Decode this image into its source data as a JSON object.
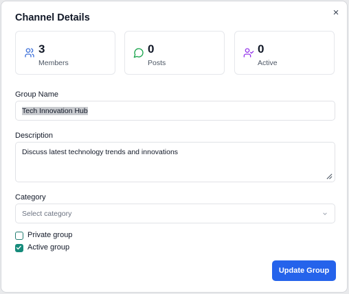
{
  "dialog": {
    "title": "Channel Details",
    "close_symbol": "×"
  },
  "stats": [
    {
      "value": "3",
      "label": "Members",
      "icon": "users-icon",
      "color": "#3b6fd9"
    },
    {
      "value": "0",
      "label": "Posts",
      "icon": "message-circle-icon",
      "color": "#16a34a"
    },
    {
      "value": "0",
      "label": "Active",
      "icon": "user-check-icon",
      "color": "#9333ea"
    }
  ],
  "form": {
    "group_name_label": "Group Name",
    "group_name_value": "Tech Innovation Hub",
    "description_label": "Description",
    "description_value": "Discuss latest technology trends and innovations",
    "category_label": "Category",
    "category_placeholder": "Select category",
    "private_label": "Private group",
    "private_checked": false,
    "active_label": "Active group",
    "active_checked": true,
    "submit_label": "Update Group"
  },
  "colors": {
    "accent": "#2563eb",
    "checkbox": "#168b7b"
  }
}
